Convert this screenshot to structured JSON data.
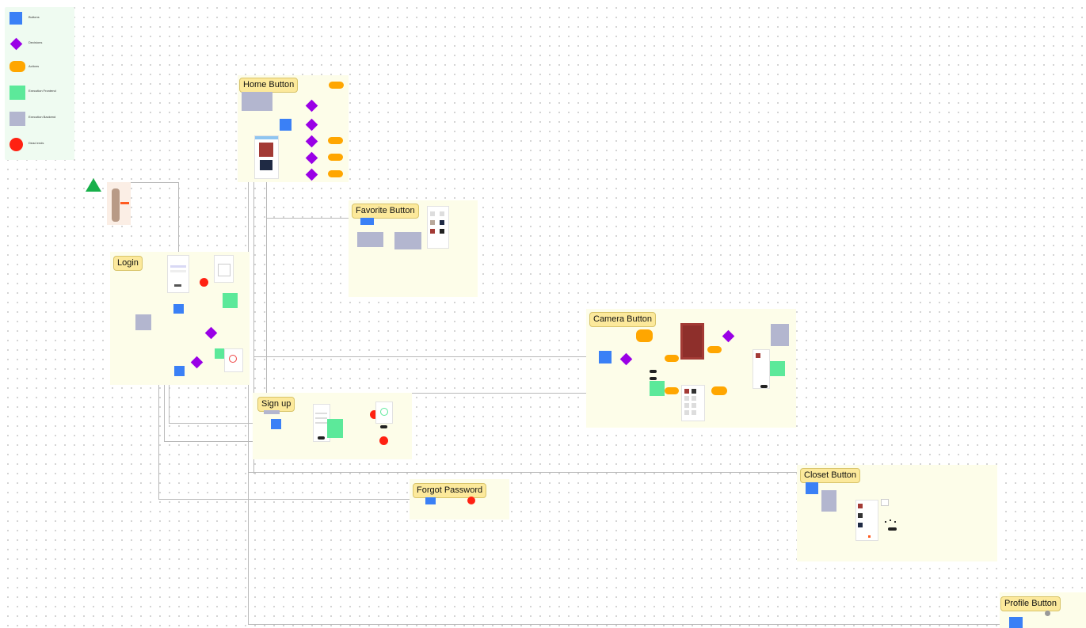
{
  "legend": {
    "items": [
      {
        "shape": "square",
        "color": "#3a80f6",
        "label": "Buttons"
      },
      {
        "shape": "diamond",
        "color": "#9a00e6",
        "label": "Decisions"
      },
      {
        "shape": "rounded",
        "color": "#ffa600",
        "label": "Actions"
      },
      {
        "shape": "square",
        "color": "#5ce99a",
        "label": "Execution Frontend"
      },
      {
        "shape": "square",
        "color": "#b3b6cf",
        "label": "Execution Backend"
      },
      {
        "shape": "circle",
        "color": "#ff2112",
        "label": "Dead ends"
      }
    ]
  },
  "sections": {
    "home": {
      "label": "Home Button"
    },
    "favorite": {
      "label": "Favorite Button"
    },
    "login": {
      "label": "Login"
    },
    "camera": {
      "label": "Camera Button"
    },
    "signup": {
      "label": "Sign up"
    },
    "forgot": {
      "label": "Forgot Password"
    },
    "closet": {
      "label": "Closet Button"
    },
    "profile": {
      "label": "Profile Button"
    }
  },
  "colors": {
    "start": "#17b04a",
    "button": "#3a80f6",
    "decision": "#9a00e6",
    "action": "#ffa600",
    "frontend": "#5ce99a",
    "backend": "#b3b6cf",
    "deadend": "#ff2112",
    "section_bg": "#fdfde9",
    "label_bg": "#fce99b"
  }
}
